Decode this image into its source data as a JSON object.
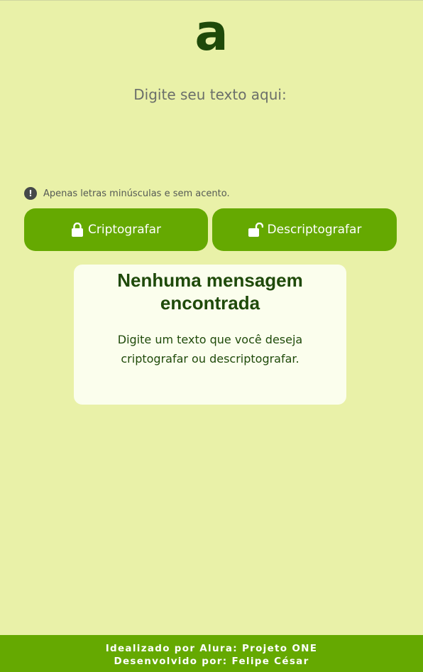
{
  "logo": {
    "glyph": "a"
  },
  "input": {
    "placeholder": "Digite seu texto aqui:",
    "value": ""
  },
  "hint": {
    "icon": "exclamation-circle-icon",
    "text": "Apenas letras minúsculas e sem acento."
  },
  "buttons": {
    "encrypt": {
      "label": "Criptografar",
      "icon": "lock-icon"
    },
    "decrypt": {
      "label": "Descriptografar",
      "icon": "unlock-icon"
    }
  },
  "output": {
    "title": "Nenhuma mensagem encontrada",
    "text": "Digite um texto que você deseja criptografar ou descriptografar."
  },
  "footer": {
    "line1": "Idealizado por Alura: Projeto ONE",
    "line2": "Desenvolvido por: Felipe César"
  },
  "colors": {
    "background": "#e9f1a8",
    "accent": "#65a901",
    "dark_green": "#1f4a0a",
    "card": "#fbfeed"
  }
}
